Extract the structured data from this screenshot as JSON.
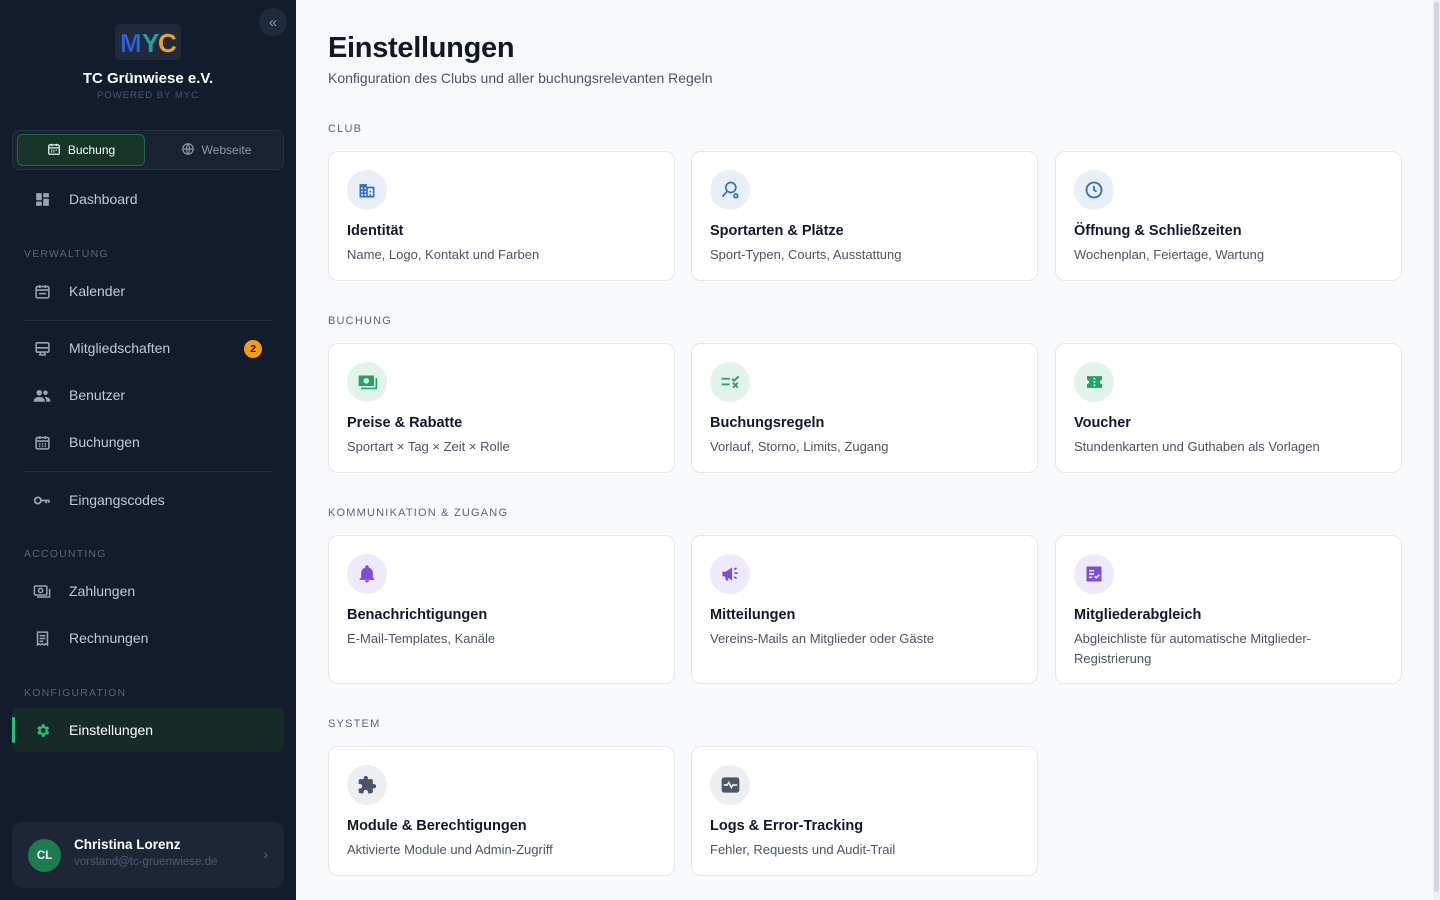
{
  "sidebar": {
    "collapse_icon": "chevrons-left-icon",
    "logo_text": "MYC",
    "club_name": "TC Grünwiese e.V.",
    "powered_by": "POWERED BY MYC",
    "mode_tabs": [
      {
        "label": "Buchung",
        "icon": "calendar-icon",
        "active": true
      },
      {
        "label": "Webseite",
        "icon": "globe-icon",
        "active": false
      }
    ],
    "dashboard": {
      "label": "Dashboard",
      "icon": "dashboard-icon"
    },
    "sections": {
      "verwaltung": "VERWALTUNG",
      "accounting": "ACCOUNTING",
      "konfiguration": "KONFIGURATION"
    },
    "items": {
      "kalender": {
        "label": "Kalender",
        "icon": "calendar-icon"
      },
      "mitgliedschaften": {
        "label": "Mitgliedschaften",
        "icon": "membership-card-icon",
        "badge": "2"
      },
      "benutzer": {
        "label": "Benutzer",
        "icon": "users-icon"
      },
      "buchungen": {
        "label": "Buchungen",
        "icon": "calendar-grid-icon"
      },
      "eingangscodes": {
        "label": "Eingangscodes",
        "icon": "key-icon"
      },
      "zahlungen": {
        "label": "Zahlungen",
        "icon": "payments-icon"
      },
      "rechnungen": {
        "label": "Rechnungen",
        "icon": "receipt-icon"
      },
      "einstellungen": {
        "label": "Einstellungen",
        "icon": "gear-icon",
        "active": true
      }
    },
    "user": {
      "initials": "CL",
      "name": "Christina Lorenz",
      "email": "vorstand@tc-gruenwiese.de"
    }
  },
  "main": {
    "title": "Einstellungen",
    "subtitle": "Konfiguration des Clubs und aller buchungsrelevanten Regeln",
    "sections": [
      {
        "title": "CLUB",
        "cards": [
          {
            "title": "Identität",
            "desc": "Name, Logo, Kontakt und Farben",
            "icon": "building-icon"
          },
          {
            "title": "Sportarten & Plätze",
            "desc": "Sport-Typen, Courts, Ausstattung",
            "icon": "racket-icon"
          },
          {
            "title": "Öffnung & Schließzeiten",
            "desc": "Wochenplan, Feiertage, Wartung",
            "icon": "clock-icon"
          }
        ]
      },
      {
        "title": "BUCHUNG",
        "cards": [
          {
            "title": "Preise & Rabatte",
            "desc": "Sportart × Tag × Zeit × Rolle",
            "icon": "money-icon"
          },
          {
            "title": "Buchungsregeln",
            "desc": "Vorlauf, Storno, Limits, Zugang",
            "icon": "rule-icon"
          },
          {
            "title": "Voucher",
            "desc": "Stundenkarten und Guthaben als Vorlagen",
            "icon": "ticket-icon"
          }
        ]
      },
      {
        "title": "KOMMUNIKATION & ZUGANG",
        "cards": [
          {
            "title": "Benachrichtigungen",
            "desc": "E-Mail-Templates, Kanäle",
            "icon": "bell-icon"
          },
          {
            "title": "Mitteilungen",
            "desc": "Vereins-Mails an Mitglieder oder Gäste",
            "icon": "megaphone-icon"
          },
          {
            "title": "Mitgliederabgleich",
            "desc": "Abgleichliste für automatische Mitglieder-Registrierung",
            "icon": "checklist-icon"
          }
        ]
      },
      {
        "title": "SYSTEM",
        "cards": [
          {
            "title": "Module & Berechtigungen",
            "desc": "Aktivierte Module und Admin-Zugriff",
            "icon": "puzzle-icon"
          },
          {
            "title": "Logs & Error-Tracking",
            "desc": "Fehler, Requests und Audit-Trail",
            "icon": "monitor-heart-icon"
          }
        ]
      }
    ]
  },
  "colors": {
    "sidebar_bg": "#131c2c",
    "accent_green": "#22c073",
    "badge_orange": "#f59e0b",
    "icon_blue": "#2f6fd0",
    "icon_green": "#1ea466",
    "icon_purple": "#7c4ddc",
    "icon_gray": "#4b5563"
  }
}
